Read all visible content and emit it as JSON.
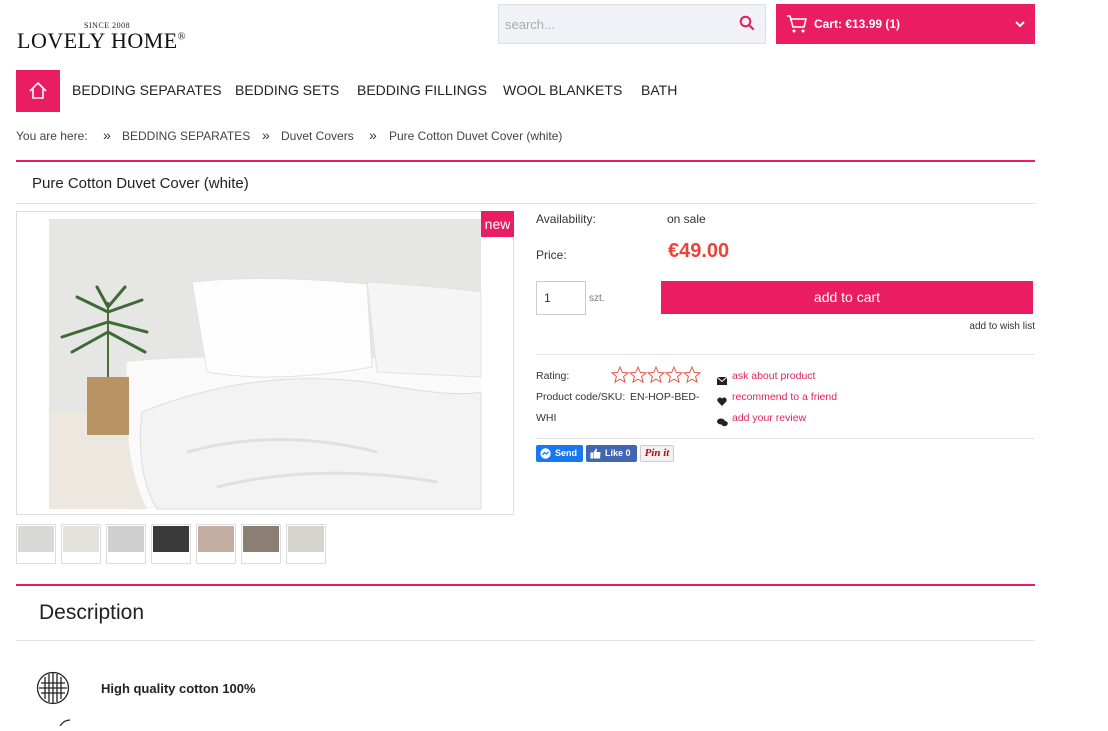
{
  "header": {
    "logo_since": "SINCE 2008",
    "logo_text": "LOVELY HOME",
    "logo_reg": "®",
    "search_placeholder": "search...",
    "cart_label": "Cart: €13.99 (1)"
  },
  "nav": {
    "items": [
      "BEDDING SEPARATES",
      "BEDDING SETS",
      "BEDDING FILLINGS",
      "WOOL BLANKETS",
      "BATH"
    ]
  },
  "breadcrumb": {
    "prefix": "You are here:",
    "separator": "»",
    "items": [
      "BEDDING SEPARATES",
      "Duvet Covers",
      "Pure Cotton Duvet Cover (white)"
    ]
  },
  "product": {
    "title": "Pure Cotton Duvet Cover (white)",
    "badge": "new",
    "availability_label": "Availability:",
    "availability_value": "on sale",
    "price_label": "Price:",
    "price": "€49.00",
    "quantity": "1",
    "unit": "szt.",
    "add_to_cart": "add to cart",
    "wishlist": "add to wish list",
    "rating_label": "Rating:",
    "rating_stars": 0,
    "rating_max": 5,
    "sku_label": "Product code/SKU:",
    "sku_value": "EN-HOP-BED-",
    "sku_value_2": "WHI",
    "ask": "ask about product",
    "recommend": "recommend to a friend",
    "review": "add your review"
  },
  "social": {
    "send": "Send",
    "like": "Like 0",
    "pin": "Pin it"
  },
  "colors": {
    "accent": "#ea1c62",
    "price": "#e8443a",
    "messenger": "#1877f2",
    "facebook": "#4267b2"
  },
  "description": {
    "title": "Description",
    "feature_1": "High quality cotton 100%"
  }
}
